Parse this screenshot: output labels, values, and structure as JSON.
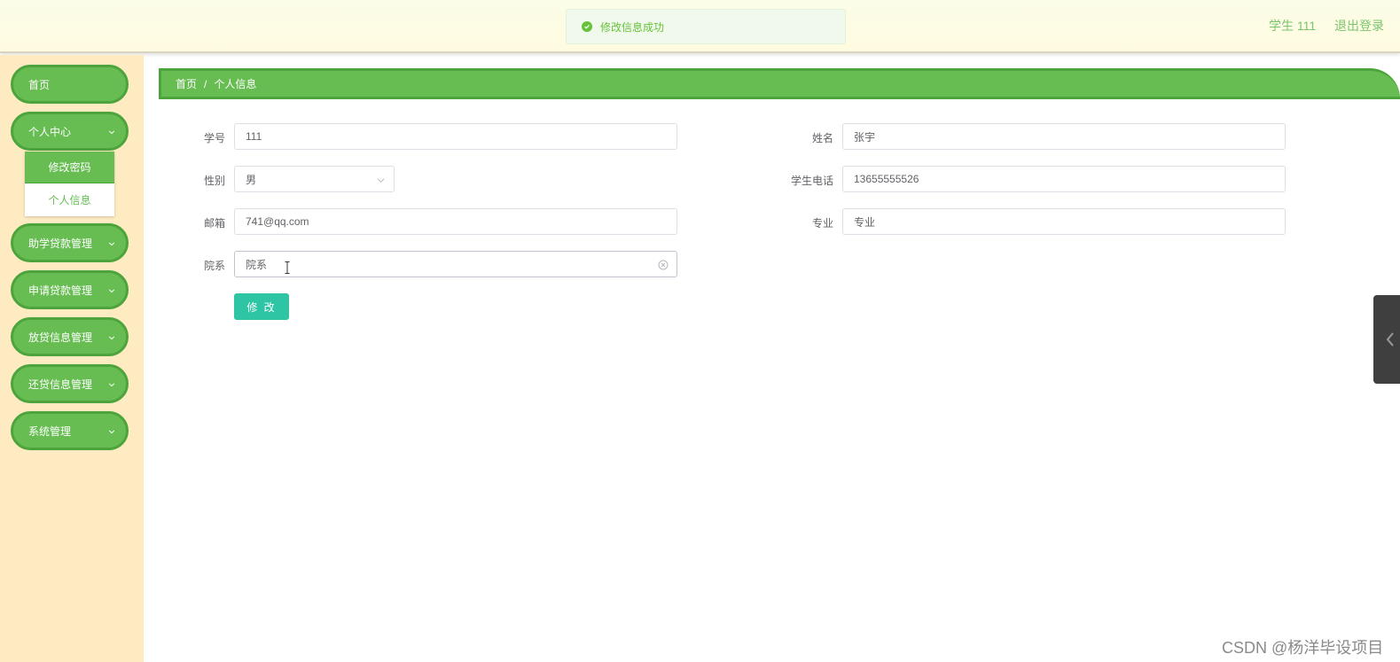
{
  "header": {
    "toast_message": "修改信息成功",
    "user_label": "学生 111",
    "logout_label": "退出登录"
  },
  "sidebar": {
    "items": [
      {
        "label": "首页"
      },
      {
        "label": "个人中心"
      },
      {
        "label": "助学贷款管理"
      },
      {
        "label": "申请贷款管理"
      },
      {
        "label": "放贷信息管理"
      },
      {
        "label": "还贷信息管理"
      },
      {
        "label": "系统管理"
      }
    ],
    "submenu": [
      {
        "label": "修改密码"
      },
      {
        "label": "个人信息"
      }
    ]
  },
  "breadcrumb": {
    "home": "首页",
    "separator": "/",
    "current": "个人信息"
  },
  "form": {
    "student_id": {
      "label": "学号",
      "value": "111"
    },
    "name": {
      "label": "姓名",
      "value": "张宇"
    },
    "gender": {
      "label": "性别",
      "value": "男"
    },
    "phone": {
      "label": "学生电话",
      "value": "13655555526"
    },
    "email": {
      "label": "邮箱",
      "value": "741@qq.com"
    },
    "major": {
      "label": "专业",
      "value": "专业"
    },
    "department": {
      "label": "院系",
      "value": "院系"
    },
    "submit_label": "修 改"
  },
  "watermark": "CSDN @杨洋毕设项目",
  "colors": {
    "accent_green": "#67bd52",
    "sidebar_bg": "#feebc2",
    "submit_teal": "#2ec5a5",
    "success": "#67c23a"
  }
}
